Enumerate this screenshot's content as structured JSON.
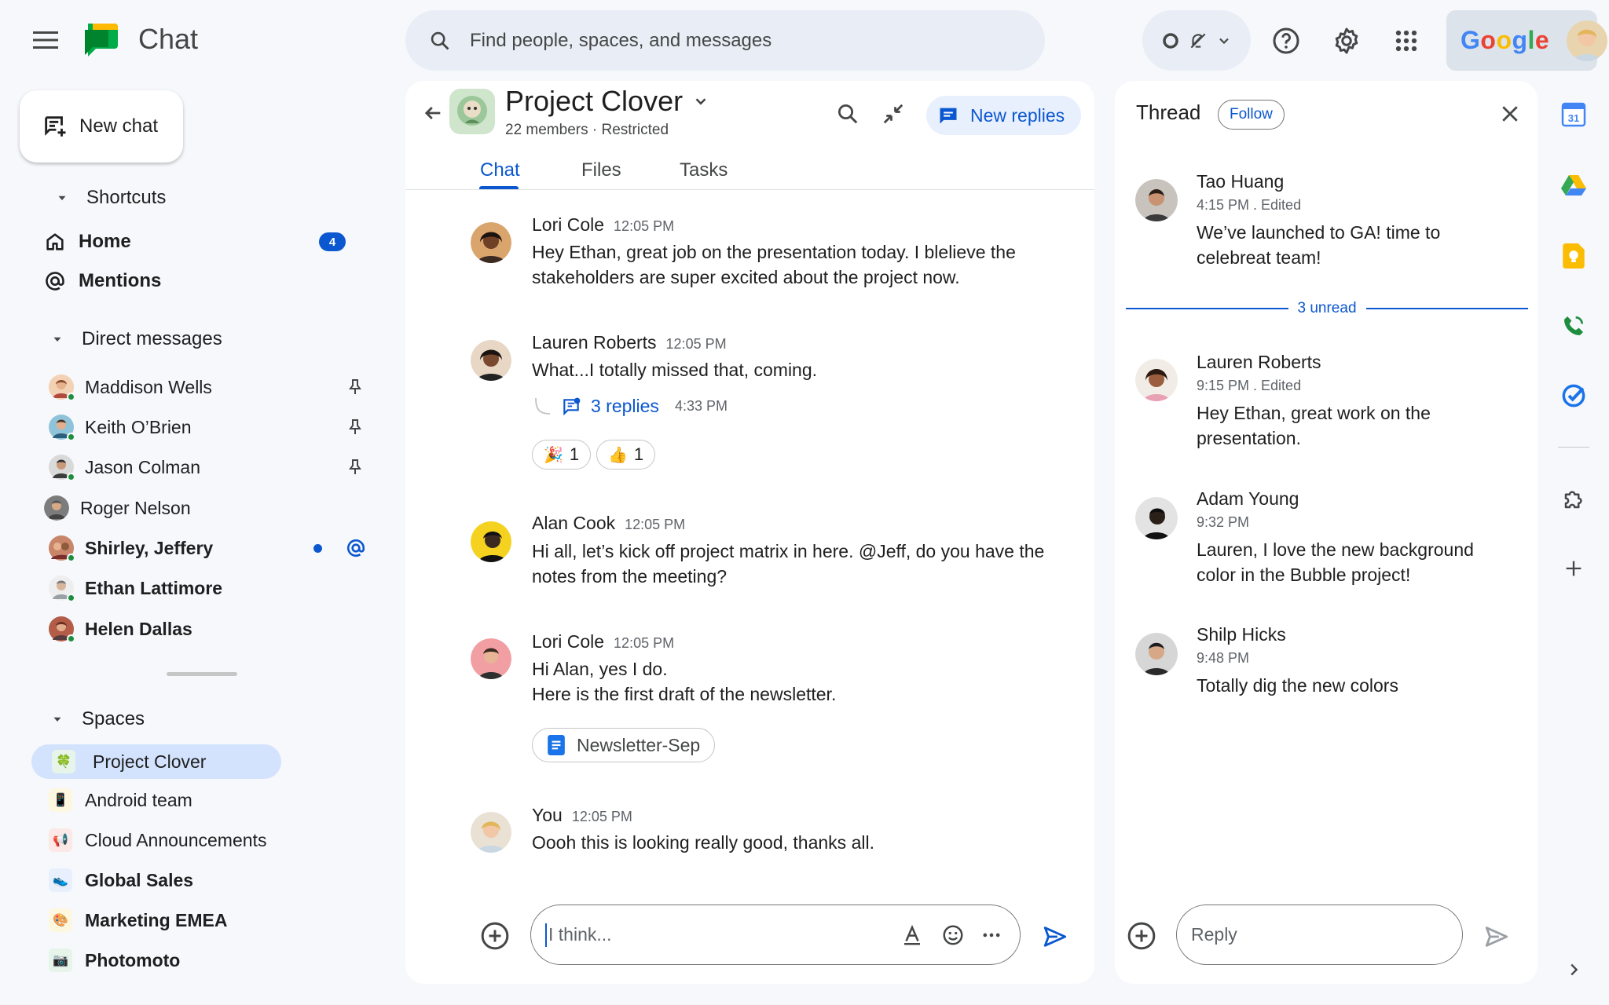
{
  "app": {
    "name": "Chat"
  },
  "search": {
    "placeholder": "Find people, spaces, and messages"
  },
  "account": {
    "brand": "Google"
  },
  "nav": {
    "new_chat": "New chat",
    "shortcuts_label": "Shortcuts",
    "home_label": "Home",
    "home_badge": "4",
    "mentions_label": "Mentions",
    "dm_label": "Direct messages",
    "dms": [
      {
        "name": "Maddison Wells"
      },
      {
        "name": "Keith O’Brien"
      },
      {
        "name": "Jason Colman"
      },
      {
        "name": "Roger Nelson"
      },
      {
        "name": "Shirley, Jeffery"
      },
      {
        "name": "Ethan Lattimore"
      },
      {
        "name": "Helen Dallas"
      }
    ],
    "spaces_label": "Spaces",
    "spaces": [
      {
        "name": "Project Clover",
        "icon": "🍀"
      },
      {
        "name": "Android team",
        "icon": "📱"
      },
      {
        "name": "Cloud Announcements",
        "icon": "📢"
      },
      {
        "name": "Global Sales",
        "icon": "👟"
      },
      {
        "name": "Marketing EMEA",
        "icon": "🎨"
      },
      {
        "name": "Photomoto",
        "icon": "📷"
      }
    ]
  },
  "space": {
    "name": "Project Clover",
    "subtitle": "22 members · Restricted",
    "new_replies": "New replies",
    "tabs": [
      "Chat",
      "Files",
      "Tasks"
    ]
  },
  "messages": [
    {
      "author": "Lori Cole",
      "time": "12:05 PM",
      "lines": [
        "Hey Ethan, great job on the presentation today. I blelieve the",
        "stakeholders are super excited about the project now."
      ]
    },
    {
      "author": "Lauren Roberts",
      "time": "12:05 PM",
      "lines": [
        "What...I totally missed that, coming."
      ],
      "replies": "3 replies",
      "replies_time": "4:33 PM",
      "reactions": [
        {
          "emoji": "🎉",
          "count": "1"
        },
        {
          "emoji": "👍",
          "count": "1"
        }
      ]
    },
    {
      "author": "Alan Cook",
      "time": "12:05 PM",
      "lines": [
        "Hi all, let’s kick off project matrix in here. @Jeff, do you have the",
        "notes from the meeting?"
      ]
    },
    {
      "author": "Lori Cole",
      "time": "12:05 PM",
      "lines": [
        "Hi Alan, yes I do.",
        "Here is the first draft of the newsletter."
      ],
      "attachment": "Newsletter-Sep"
    },
    {
      "author": "You",
      "time": "12:05 PM",
      "lines": [
        "Oooh this is looking really good, thanks all."
      ]
    }
  ],
  "composer": {
    "value": "I think..."
  },
  "thread": {
    "title": "Thread",
    "follow": "Follow",
    "unread": "3 unread",
    "reply_placeholder": "Reply",
    "items": [
      {
        "author": "Tao Huang",
        "meta": "4:15 PM . Edited",
        "lines": [
          "We’ve launched to GA! time to",
          "celebreat team!"
        ]
      },
      {
        "author": "Lauren Roberts",
        "meta": "9:15 PM . Edited",
        "lines": [
          "Hey Ethan, great work on the",
          "presentation."
        ]
      },
      {
        "author": "Adam Young",
        "meta": "9:32 PM",
        "lines": [
          "Lauren, I love the new background",
          "color in the Bubble project!"
        ]
      },
      {
        "author": "Shilp Hicks",
        "meta": "9:48 PM",
        "lines": [
          "Totally dig the new colors"
        ]
      }
    ]
  },
  "sidepanel": {
    "calendar_day": "31"
  },
  "colors": {
    "accent": "#0b57d0",
    "selected": "#d3e3fd",
    "background": "#f6f8fc"
  }
}
